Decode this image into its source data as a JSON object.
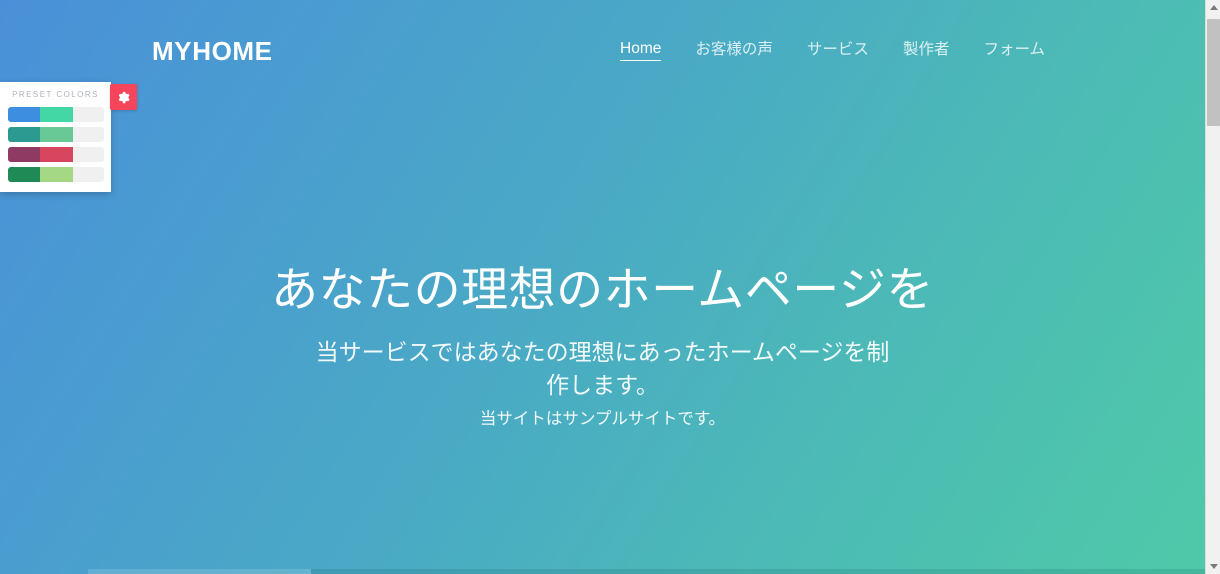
{
  "header": {
    "brand": "MYHOME",
    "nav": [
      {
        "label": "Home",
        "active": true
      },
      {
        "label": "お客様の声",
        "active": false
      },
      {
        "label": "サービス",
        "active": false
      },
      {
        "label": "製作者",
        "active": false
      },
      {
        "label": "フォーム",
        "active": false
      }
    ]
  },
  "hero": {
    "title": "あなたの理想のホームページを",
    "subtitle": "当サービスではあなたの理想にあったホームページを制作します。",
    "note": "当サイトはサンプルサイトです。"
  },
  "preset_panel": {
    "title": "PRESET COLORS",
    "toggle_icon": "gear-icon",
    "toggle_color": "#f4455b",
    "swatches": [
      {
        "name": "blue-green",
        "colors": [
          "#3d8ee0",
          "#43d7a5",
          "#f0f0f0"
        ]
      },
      {
        "name": "teal-green",
        "colors": [
          "#2d9a92",
          "#68c896",
          "#f0f0f0"
        ]
      },
      {
        "name": "purple-red",
        "colors": [
          "#8e3a63",
          "#d8455f",
          "#f0f0f0"
        ]
      },
      {
        "name": "green-lime",
        "colors": [
          "#1f8a55",
          "#a4d884",
          "#f0f0f0"
        ]
      }
    ]
  },
  "background": {
    "gradient_from": "#4a90d9",
    "gradient_to": "#4fc9a8"
  },
  "scrollbar": {
    "up_arrow": "chevron-up-icon",
    "down_arrow": "chevron-down-icon",
    "thumb_position_percent": 3
  }
}
